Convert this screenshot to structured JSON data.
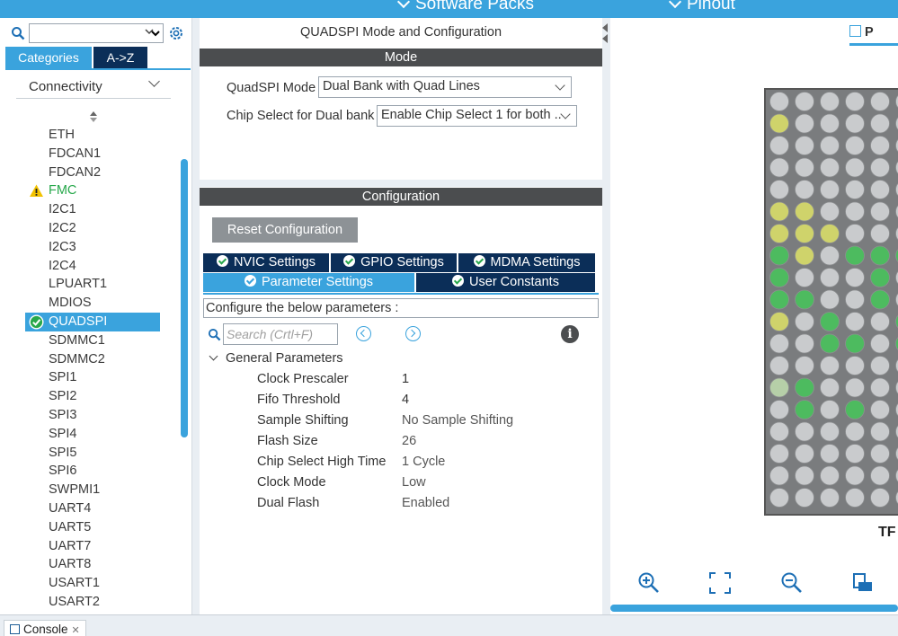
{
  "ribbon": {
    "software_packs": "Software Packs",
    "pinout": "Pinout"
  },
  "left": {
    "tabs": {
      "categories": "Categories",
      "az": "A->Z"
    },
    "group": "Connectivity",
    "peripherals": [
      {
        "label": "ETH",
        "state": "normal"
      },
      {
        "label": "FDCAN1",
        "state": "normal"
      },
      {
        "label": "FDCAN2",
        "state": "normal"
      },
      {
        "label": "FMC",
        "state": "warning"
      },
      {
        "label": "I2C1",
        "state": "normal"
      },
      {
        "label": "I2C2",
        "state": "normal"
      },
      {
        "label": "I2C3",
        "state": "normal"
      },
      {
        "label": "I2C4",
        "state": "normal"
      },
      {
        "label": "LPUART1",
        "state": "normal"
      },
      {
        "label": "MDIOS",
        "state": "normal"
      },
      {
        "label": "QUADSPI",
        "state": "selected"
      },
      {
        "label": "SDMMC1",
        "state": "normal"
      },
      {
        "label": "SDMMC2",
        "state": "normal"
      },
      {
        "label": "SPI1",
        "state": "normal"
      },
      {
        "label": "SPI2",
        "state": "normal"
      },
      {
        "label": "SPI3",
        "state": "normal"
      },
      {
        "label": "SPI4",
        "state": "normal"
      },
      {
        "label": "SPI5",
        "state": "normal"
      },
      {
        "label": "SPI6",
        "state": "normal"
      },
      {
        "label": "SWPMI1",
        "state": "normal"
      },
      {
        "label": "UART4",
        "state": "normal"
      },
      {
        "label": "UART5",
        "state": "normal"
      },
      {
        "label": "UART7",
        "state": "normal"
      },
      {
        "label": "UART8",
        "state": "normal"
      },
      {
        "label": "USART1",
        "state": "normal"
      },
      {
        "label": "USART2",
        "state": "normal"
      }
    ]
  },
  "mid": {
    "title": "QUADSPI Mode and Configuration",
    "mode_bar": "Mode",
    "mode_label": "QuadSPI Mode",
    "mode_value": "Dual Bank with Quad Lines",
    "cs_label": "Chip Select for Dual bank",
    "cs_value": "Enable Chip Select 1 for both ..",
    "config_bar": "Configuration",
    "reset_button": "Reset Configuration",
    "tabs": {
      "nvic": "NVIC Settings",
      "gpio": "GPIO Settings",
      "mdma": "MDMA Settings",
      "params": "Parameter Settings",
      "user": "User Constants"
    },
    "configure_text": "Configure the below parameters :",
    "search_placeholder": "Search (Crtl+F)",
    "info_glyph": "i",
    "group": "General Parameters",
    "params": [
      {
        "name": "Clock Prescaler",
        "value": "1"
      },
      {
        "name": "Fifo Threshold",
        "value": "4"
      },
      {
        "name": "Sample Shifting",
        "value": "No Sample Shifting"
      },
      {
        "name": "Flash Size",
        "value": "26"
      },
      {
        "name": "Chip Select High Time",
        "value": "1 Cycle"
      },
      {
        "name": "Clock Mode",
        "value": "Low"
      },
      {
        "name": "Dual Flash",
        "value": "Enabled"
      }
    ]
  },
  "right": {
    "pinout_tab": "P",
    "package_label": "TF"
  },
  "console": {
    "tab": "Console",
    "close": "✕"
  },
  "colors": {
    "accent": "#3aa3dd",
    "navy": "#0b2e58",
    "bar": "#4b4d4f",
    "green": "#27a84b"
  }
}
